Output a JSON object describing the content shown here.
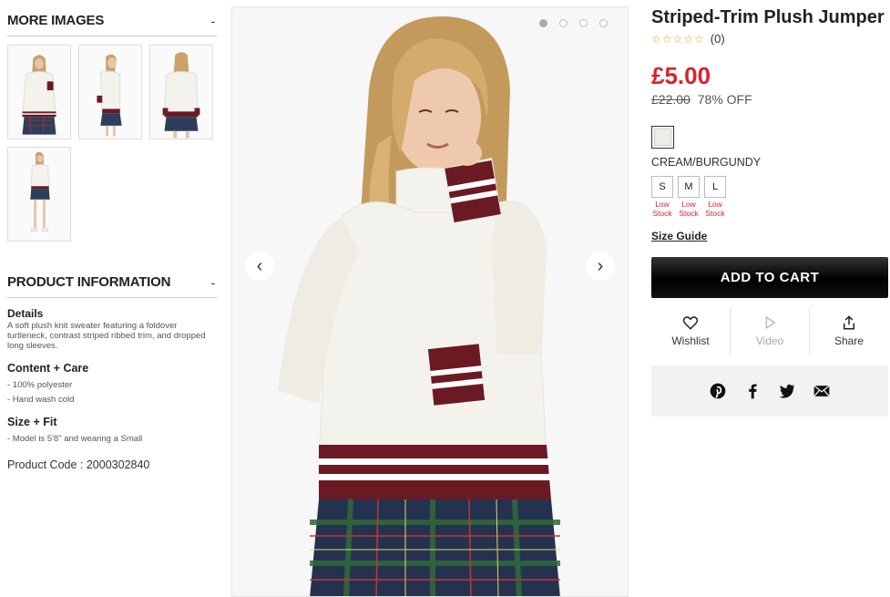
{
  "more_images": {
    "title": "MORE IMAGES",
    "toggle": "-",
    "thumbnails": [
      "front-view",
      "side-view",
      "back-view",
      "full-length-view"
    ]
  },
  "product_info": {
    "title": "PRODUCT INFORMATION",
    "toggle": "-",
    "details_title": "Details",
    "details_text": "A soft plush knit sweater featuring a foldover turtleneck, contrast striped ribbed trim, and dropped long sleeves.",
    "content_title": "Content + Care",
    "content_items": [
      "- 100% polyester",
      "- Hand wash cold"
    ],
    "size_fit_title": "Size + Fit",
    "size_fit_items": [
      "- Model is 5'8\" and wearing a Small"
    ],
    "product_code": "Product Code : 2000302840"
  },
  "gallery": {
    "prev": "‹",
    "next": "›",
    "dot_count": 4,
    "active_dot": 0
  },
  "product": {
    "title": "Striped-Trim Plush Jumper",
    "stars": "☆☆☆☆☆",
    "review_count": "(0)",
    "price": "£5.00",
    "old_price": "£22.00",
    "discount": "78% OFF",
    "color_name": "CREAM/BURGUNDY",
    "swatch_color": "#efeee6",
    "sizes": [
      {
        "label": "S",
        "stock": "Low Stock"
      },
      {
        "label": "M",
        "stock": "Low Stock"
      },
      {
        "label": "L",
        "stock": "Low Stock"
      }
    ],
    "size_guide": "Size Guide",
    "add_to_cart": "ADD TO CART"
  },
  "actions": {
    "wishlist": "Wishlist",
    "video": "Video",
    "share": "Share"
  },
  "social": [
    "pinterest-icon",
    "facebook-icon",
    "twitter-icon",
    "email-icon"
  ],
  "colors": {
    "price_red": "#d8232a",
    "burgundy": "#6b1a24",
    "cream": "#f4f2ec"
  }
}
